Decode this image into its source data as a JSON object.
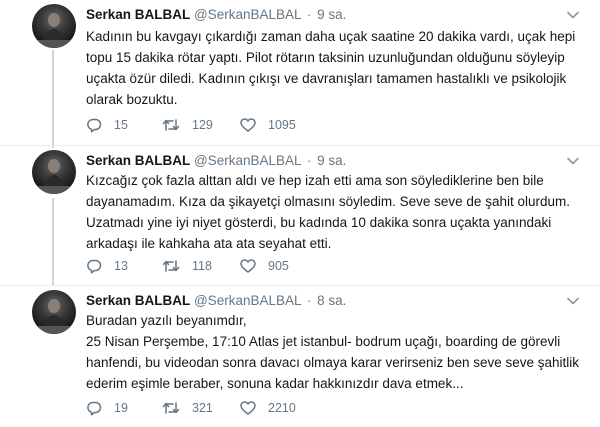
{
  "tweets": [
    {
      "author": {
        "name": "Serkan BALBAL",
        "handle": "@SerkanBALBAL"
      },
      "time": "9 sa.",
      "lines": [
        "Kadının bu kavgayı çıkardığı zaman daha uçak saatine 20 dakika vardı, uçak hepi",
        "topu 15 dakika rötar yaptı. Pilot rötarın taksinin uzunluğundan olduğunu söyleyip",
        "uçakta özür diledi.  Kadının çıkışı ve davranışları tamamen hastalıklı ve psikolojik",
        "olarak bozuktu."
      ],
      "stats": {
        "replies": "15",
        "retweets": "129",
        "likes": "1095"
      }
    },
    {
      "author": {
        "name": "Serkan BALBAL",
        "handle": "@SerkanBALBAL"
      },
      "time": "9 sa.",
      "lines": [
        "Kızcağız çok fazla alttan aldı ve hep izah etti ama son söylediklerine ben bile",
        "dayanamadım. Kıza da şikayetçi olmasını söyledim. Seve seve de şahit olurdum.",
        "Uzatmadı yine iyi niyet gösterdi, bu kadında 10 dakika sonra uçakta yanındaki",
        "arkadaşı ile kahkaha ata ata seyahat etti."
      ],
      "stats": {
        "replies": "13",
        "retweets": "118",
        "likes": "905"
      }
    },
    {
      "author": {
        "name": "Serkan BALBAL",
        "handle": "@SerkanBALBAL"
      },
      "time": "8 sa.",
      "lines": [
        "Buradan yazılı beyanımdır,",
        "25 Nisan Perşembe, 17:10 Atlas jet istanbul- bodrum uçağı, boarding de görevli",
        "hanfendi, bu videodan sonra davacı olmaya karar verirseniz ben seve seve şahitlik",
        "ederim eşimle beraber, sonuna kadar hakkınızdır dava etmek..."
      ],
      "stats": {
        "replies": "19",
        "retweets": "321",
        "likes": "2210"
      }
    }
  ],
  "colors": {
    "text": "#14171a",
    "muted": "#657786",
    "divider": "#e6ecf0",
    "thread": "#ccd6dd"
  },
  "icons": [
    "avatar",
    "chevron-down-icon",
    "reply-icon",
    "retweet-icon",
    "like-icon"
  ]
}
